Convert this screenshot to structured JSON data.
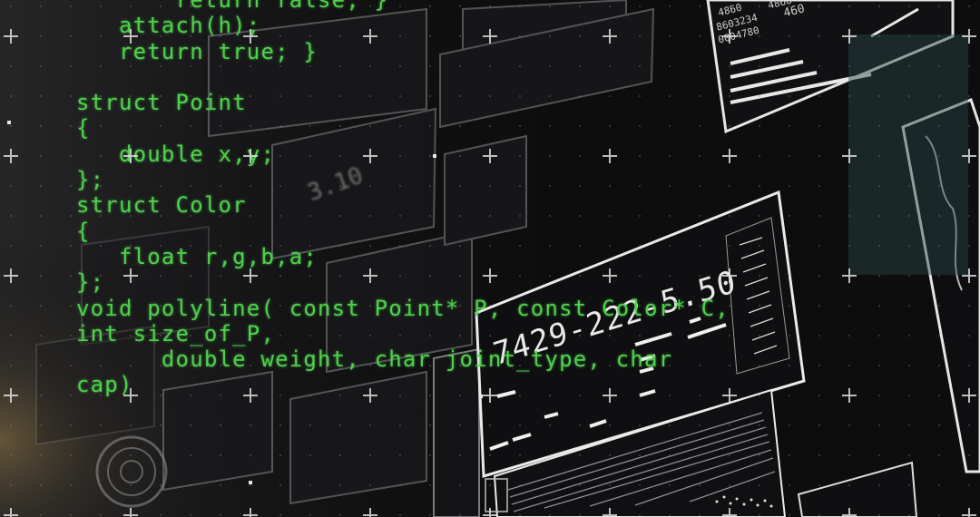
{
  "code": {
    "lines": [
      "       return false; }",
      "   attach(h);",
      "   return true; }",
      "",
      "struct Point",
      "{",
      "   double x,y;",
      "};",
      "struct Color",
      "{",
      "   float r,g,b,a;",
      "};",
      "void polyline( const Point* P, const Color* C,",
      "int size_of_P,",
      "      double weight, char joint_type, char",
      "cap)"
    ],
    "color": "#4fd14b"
  },
  "hud": {
    "big_readout": "7429-222-5.50",
    "blurred_readout": "3.10",
    "small_values": [
      "4860",
      "4868",
      "8603234",
      "0004780",
      "460"
    ],
    "accent": "#e9e9e9"
  }
}
